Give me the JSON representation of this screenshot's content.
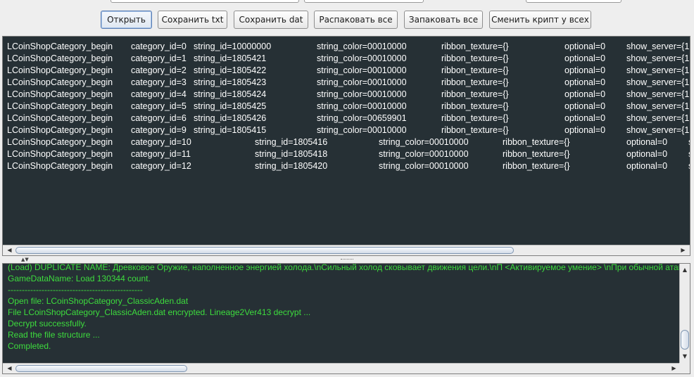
{
  "toolbar": {
    "buttons": [
      {
        "label": "Открыть"
      },
      {
        "label": "Сохранить txt"
      },
      {
        "label": "Сохранить dat"
      },
      {
        "label": "Распаковать все"
      },
      {
        "label": "Запаковать все"
      },
      {
        "label": "Сменить крипт у всех"
      }
    ]
  },
  "data_rows": [
    [
      "LCoinShopCategory_begin",
      "category_id=0",
      "string_id=10000000",
      "string_color=00010000",
      "ribbon_texture={}",
      "optional=0",
      "show_server={1"
    ],
    [
      "LCoinShopCategory_begin",
      "category_id=1",
      "string_id=1805421",
      "string_color=00010000",
      "ribbon_texture={}",
      "optional=0",
      "show_server={1"
    ],
    [
      "LCoinShopCategory_begin",
      "category_id=2",
      "string_id=1805422",
      "string_color=00010000",
      "ribbon_texture={}",
      "optional=0",
      "show_server={1"
    ],
    [
      "LCoinShopCategory_begin",
      "category_id=3",
      "string_id=1805423",
      "string_color=00010000",
      "ribbon_texture={}",
      "optional=0",
      "show_server={1"
    ],
    [
      "LCoinShopCategory_begin",
      "category_id=4",
      "string_id=1805424",
      "string_color=00010000",
      "ribbon_texture={}",
      "optional=0",
      "show_server={1"
    ],
    [
      "LCoinShopCategory_begin",
      "category_id=5",
      "string_id=1805425",
      "string_color=00010000",
      "ribbon_texture={}",
      "optional=0",
      "show_server={1"
    ],
    [
      "LCoinShopCategory_begin",
      "category_id=6",
      "string_id=1805426",
      "string_color=00659901",
      "ribbon_texture={}",
      "optional=0",
      "show_server={1"
    ],
    [
      "LCoinShopCategory_begin",
      "category_id=9",
      "string_id=1805415",
      "string_color=00010000",
      "ribbon_texture={}",
      "optional=0",
      "show_server={1"
    ],
    [
      "LCoinShopCategory_begin",
      "category_id=10",
      "string_id=1805416",
      "string_color=00010000",
      "ribbon_texture={}",
      "optional=0",
      "s"
    ],
    [
      "LCoinShopCategory_begin",
      "category_id=11",
      "string_id=1805418",
      "string_color=00010000",
      "ribbon_texture={}",
      "optional=0",
      "s"
    ],
    [
      "LCoinShopCategory_begin",
      "category_id=12",
      "string_id=1805420",
      "string_color=00010000",
      "ribbon_texture={}",
      "optional=0",
      "s"
    ]
  ],
  "log_lines": [
    "(Load) DUPLICATE NAME: Древковое Оружие, наполненное энергией холода.\\nСильный холод сковывает движения цели.\\nП <Активируемое умение> \\nПри обычной атаке",
    "GameDataName: Load 130344 count.",
    "------------------------------------------------",
    "Open file: LCoinShopCategory_ClassicAden.dat",
    "File LCoinShopCategory_ClassicAden.dat encrypted. Lineage2Ver413 decrypt ...",
    "Decrypt successfully.",
    "Read the file structure ...",
    "Completed."
  ],
  "colors": {
    "panel_bg": "#263035",
    "data_text": "#ffffff",
    "log_text": "#3ddc3d"
  }
}
